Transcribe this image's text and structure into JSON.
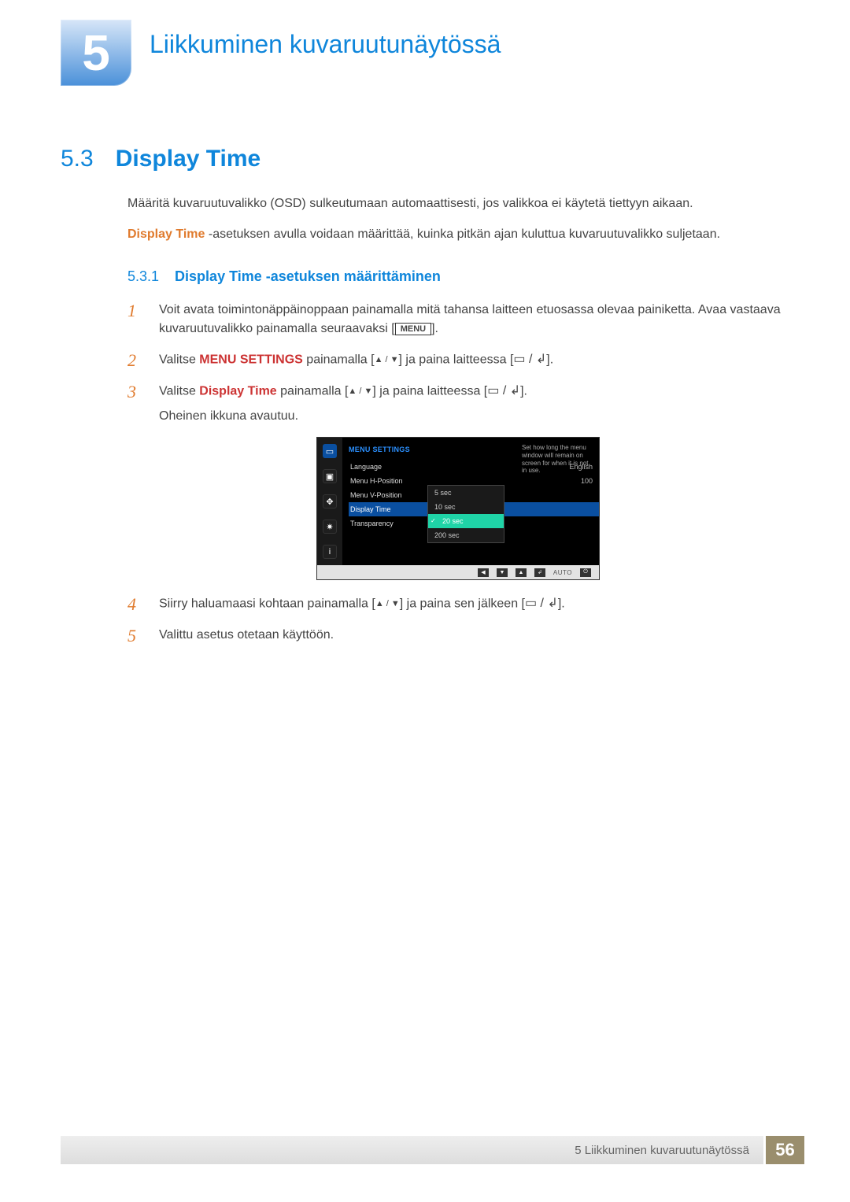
{
  "chapter": {
    "num": "5",
    "title": "Liikkuminen kuvaruutunäytössä"
  },
  "section": {
    "num": "5.3",
    "title": "Display Time"
  },
  "intro_para": "Määritä kuvaruutuvalikko (OSD) sulkeutumaan automaattisesti, jos valikkoa ei käytetä tiettyyn aikaan.",
  "intro_para2_lead": "Display Time",
  "intro_para2_rest": " -asetuksen avulla voidaan määrittää, kuinka pitkän ajan kuluttua kuvaruutuvalikko suljetaan.",
  "subsection": {
    "num": "5.3.1",
    "title": "Display Time -asetuksen määrittäminen"
  },
  "steps": {
    "s1a": "Voit avata toimintonäppäinoppaan painamalla mitä tahansa laitteen etuosassa olevaa painiketta. Avaa vastaava kuvaruutuvalikko painamalla seuraavaksi [",
    "s1b": "].",
    "menu_pill": "MENU",
    "s2a": "Valitse ",
    "s2_bold": "MENU SETTINGS",
    "s2b": " painamalla [",
    "s2c": "] ja paina laitteessa [",
    "s2d": "].",
    "s3a": "Valitse ",
    "s3_bold": "Display Time",
    "s3b": " painamalla [",
    "s3c": "] ja paina laitteessa [",
    "s3d": "].",
    "s3e": "Oheinen ikkuna avautuu.",
    "s4a": "Siirry haluamaasi kohtaan painamalla [",
    "s4b": "] ja paina sen jälkeen [",
    "s4c": "].",
    "s5": "Valittu asetus otetaan käyttöön."
  },
  "osd": {
    "heading": "MENU SETTINGS",
    "rows": [
      {
        "label": "Language",
        "value": "English"
      },
      {
        "label": "Menu H-Position",
        "value": "100"
      },
      {
        "label": "Menu V-Position",
        "value": ""
      },
      {
        "label": "Display Time",
        "value": ""
      },
      {
        "label": "Transparency",
        "value": ""
      }
    ],
    "popup": [
      "5 sec",
      "10 sec",
      "20 sec",
      "200 sec"
    ],
    "popup_selected_index": 2,
    "tip": "Set how long the menu window will remain on screen for when it is not in use.",
    "bar_auto": "AUTO"
  },
  "footer": {
    "text": "5 Liikkuminen kuvaruutunäytössä",
    "page": "56"
  }
}
